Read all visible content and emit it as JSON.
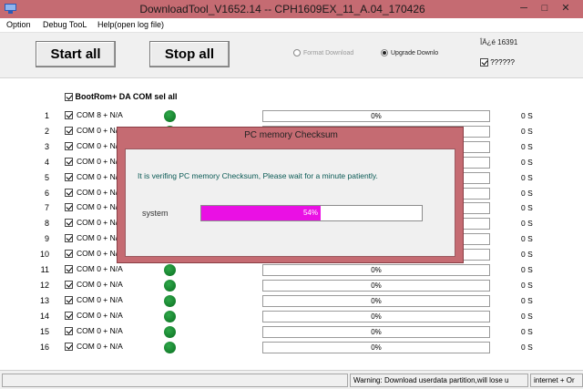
{
  "window": {
    "title": "DownloadTool_V1652.14 -- CPH1609EX_11_A.04_170426",
    "controls": [
      "─",
      "□",
      "✕"
    ]
  },
  "menu": [
    "Option",
    "Debug TooL",
    "Help(open log file)"
  ],
  "toolbar": {
    "start_label": "Start all",
    "stop_label": "Stop all",
    "format_label": "Format Download",
    "upgrade_label": "Upgrade Downlo",
    "info_text": "ÎÄ¿é 16391",
    "checkbox_label": "??????"
  },
  "select_all_label": "BootRom+ DA COM sel all",
  "rows": [
    {
      "num": "1",
      "port": "COM 8 + N/A",
      "progress": "0%",
      "time": "0 S"
    },
    {
      "num": "2",
      "port": "COM 0 + N/A",
      "progress": "0%",
      "time": "0 S"
    },
    {
      "num": "3",
      "port": "COM 0 + N/A",
      "progress": "0%",
      "time": "0 S"
    },
    {
      "num": "4",
      "port": "COM 0 + N/A",
      "progress": "0%",
      "time": "0 S"
    },
    {
      "num": "5",
      "port": "COM 0 + N/A",
      "progress": "0%",
      "time": "0 S"
    },
    {
      "num": "6",
      "port": "COM 0 + N/A",
      "progress": "0%",
      "time": "0 S"
    },
    {
      "num": "7",
      "port": "COM 0 + N/A",
      "progress": "0%",
      "time": "0 S"
    },
    {
      "num": "8",
      "port": "COM 0 + N/A",
      "progress": "0%",
      "time": "0 S"
    },
    {
      "num": "9",
      "port": "COM 0 + N/A",
      "progress": "0%",
      "time": "0 S"
    },
    {
      "num": "10",
      "port": "COM 0 + N/A",
      "progress": "0%",
      "time": "0 S"
    },
    {
      "num": "11",
      "port": "COM 0 + N/A",
      "progress": "0%",
      "time": "0 S"
    },
    {
      "num": "12",
      "port": "COM 0 + N/A",
      "progress": "0%",
      "time": "0 S"
    },
    {
      "num": "13",
      "port": "COM 0 + N/A",
      "progress": "0%",
      "time": "0 S"
    },
    {
      "num": "14",
      "port": "COM 0 + N/A",
      "progress": "0%",
      "time": "0 S"
    },
    {
      "num": "15",
      "port": "COM 0 + N/A",
      "progress": "0%",
      "time": "0 S"
    },
    {
      "num": "16",
      "port": "COM 0 + N/A",
      "progress": "0%",
      "time": "0 S"
    }
  ],
  "status": {
    "warning": "Warning: Download userdata partition,will lose u",
    "net": "internet + Or"
  },
  "dialog": {
    "title": "PC memory Checksum",
    "message": "It is verifing PC memory Checksum, Please wait for a minute  patiently.",
    "label": "system",
    "progress_text": "54%",
    "progress_fraction": 0.54
  },
  "colors": {
    "titlebar": "#c56b72",
    "progress_fill": "#ea10e4",
    "led": "#0f8a2a"
  }
}
